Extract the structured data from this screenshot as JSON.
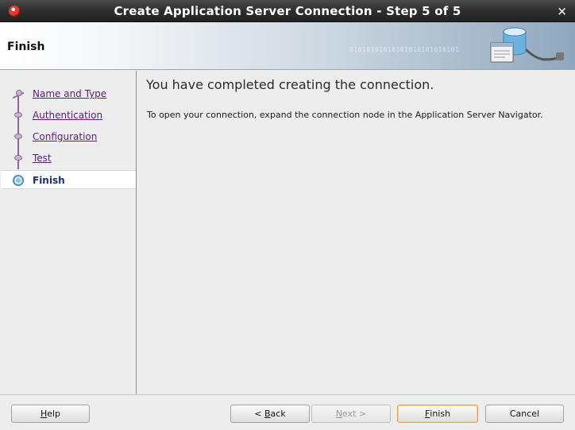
{
  "window": {
    "title": "Create Application Server Connection - Step 5 of 5",
    "close_glyph": "×"
  },
  "header": {
    "page_title": "Finish",
    "binary_text": "01010101010101010101010101"
  },
  "steps": [
    {
      "label": "Name and Type",
      "state": "done"
    },
    {
      "label": "Authentication",
      "state": "done"
    },
    {
      "label": "Configuration",
      "state": "done"
    },
    {
      "label": "Test",
      "state": "done"
    },
    {
      "label": "Finish",
      "state": "current"
    }
  ],
  "content": {
    "heading": "You have completed creating the connection.",
    "description": "To open your connection, expand the connection node in the Application Server Navigator."
  },
  "buttons": {
    "help": {
      "mnemonic": "H",
      "rest": "elp"
    },
    "back": {
      "prefix": "< ",
      "mnemonic": "B",
      "rest": "ack"
    },
    "next": {
      "mnemonic": "N",
      "rest": "ext >"
    },
    "finish": {
      "mnemonic": "F",
      "rest": "inish"
    },
    "cancel": {
      "label": "Cancel"
    }
  },
  "colors": {
    "link": "#5a1e7a",
    "current_step": "#1a2f6b",
    "default_button_border": "#e0a04a"
  }
}
